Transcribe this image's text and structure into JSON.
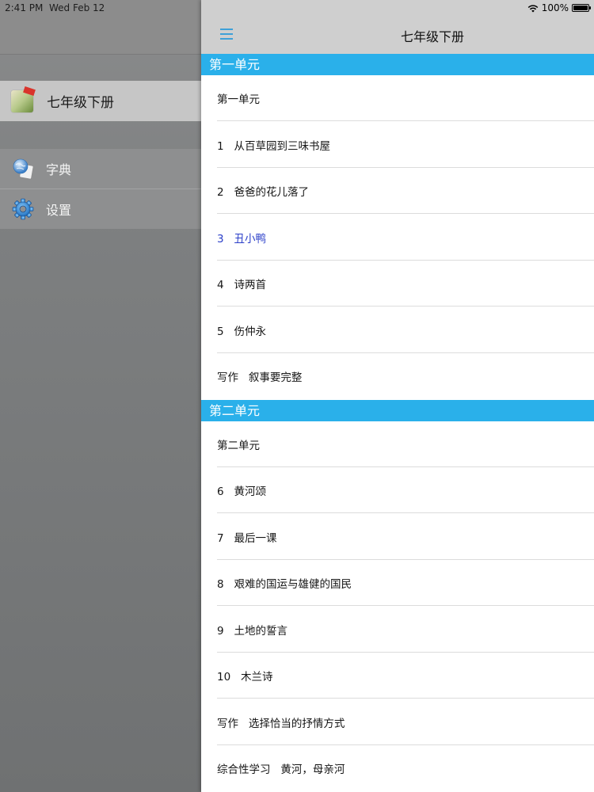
{
  "status_bar": {
    "time": "2:41 PM",
    "date": "Wed Feb 12",
    "battery": "100%",
    "battery_level": 1.0
  },
  "sidebar": {
    "book": {
      "label": "七年级下册",
      "icon": "book-cover-thumbnail"
    },
    "items": [
      {
        "label": "字典",
        "icon": "dictionary-icon"
      },
      {
        "label": "设置",
        "icon": "gear-icon"
      }
    ]
  },
  "nav": {
    "title": "七年级下册",
    "menu_icon": "hamburger-menu-icon"
  },
  "units": [
    {
      "header": "第一单元",
      "rows": [
        "第一单元",
        "1   从百草园到三味书屋",
        "2   爸爸的花儿落了",
        "3   丑小鸭",
        "4   诗两首",
        "5   伤仲永",
        "写作   叙事要完整"
      ]
    },
    {
      "header": "第二单元",
      "rows": [
        "第二单元",
        "6   黄河颂",
        "7   最后一课",
        "8   艰难的国运与雄健的国民",
        "9   土地的誓言",
        "10   木兰诗",
        "写作   选择恰当的抒情方式",
        "综合性学习   黄河，母亲河"
      ]
    }
  ],
  "colors": {
    "section_header": "#2ab0ea",
    "selected_text": "#2b3fc9",
    "hamburger": "#3ea0d8"
  }
}
